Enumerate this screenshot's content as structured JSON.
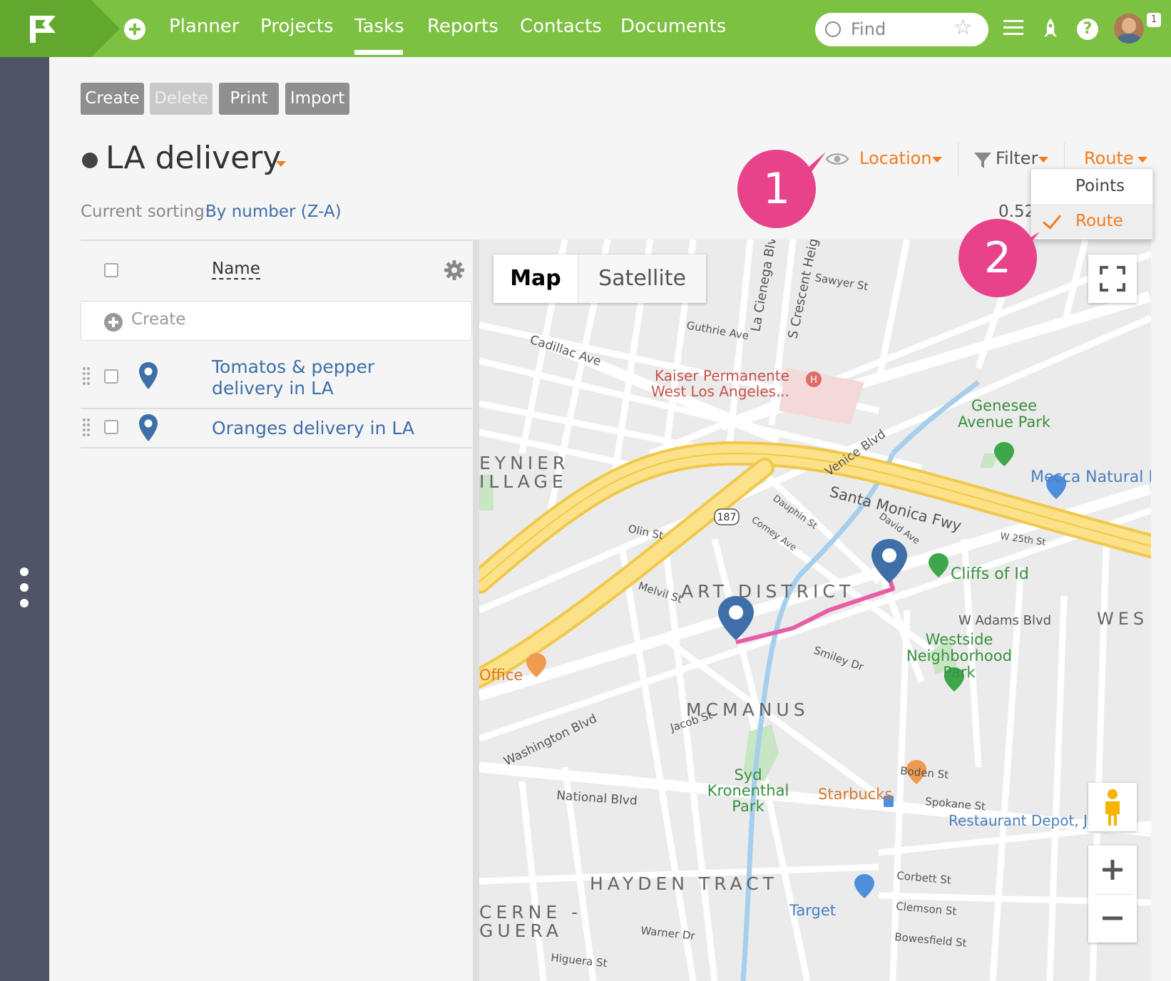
{
  "topbar": {
    "nav": [
      "Planner",
      "Projects",
      "Tasks",
      "Reports",
      "Contacts",
      "Documents"
    ],
    "active_nav": "Tasks",
    "search_placeholder": "Find",
    "notification_count": "1",
    "help_glyph": "?"
  },
  "toolbar": {
    "create": "Create",
    "delete": "Delete",
    "print": "Print",
    "import": "Import"
  },
  "header": {
    "title": "LA delivery",
    "sorting_label": "Current sorting:",
    "sorting_value": "By number (Z-A)",
    "location_label": "Location",
    "filter_label": "Filter",
    "route_label": "Route",
    "scale_text": "0.52"
  },
  "route_menu": {
    "options": [
      "Points",
      "Route"
    ],
    "selected": "Route"
  },
  "annotations": [
    "1",
    "2"
  ],
  "task_list": {
    "column_name": "Name",
    "create_label": "Create",
    "tasks": [
      {
        "name": "Tomatos & pepper delivery in LA"
      },
      {
        "name": "Oranges delivery in LA"
      }
    ]
  },
  "map": {
    "type_options": [
      "Map",
      "Satellite"
    ],
    "active_type": "Map",
    "labels": {
      "kaiser": "Kaiser Permanente",
      "kaiser2": "West Los Angeles...",
      "genesee": "Genesee",
      "genesee2": "Avenue Park",
      "mecca": "Mecca Natural M",
      "cliffs": "Cliffs of Id",
      "adams": "W Adams Blvd",
      "westside": "Westside",
      "westside2": "Neighborhood",
      "westside3": "Park",
      "art": "ART DISTRICT",
      "mcmanus": "MCMANUS",
      "hayden": "HAYDEN TRACT",
      "reynier": "EYNIER",
      "reynier2": "ILLAGE",
      "cerne": "CERNE -",
      "cerne2": "GUERA",
      "santa": "Santa Monica Fwy",
      "venice": "Venice Blvd",
      "washington": "Washington Blvd",
      "national": "National Blvd",
      "starbucks": "Starbucks",
      "restaurant": "Restaurant Depot, Jetro",
      "target": "Target",
      "office": "Office",
      "syd": "Syd",
      "syd2": "Kronenthal",
      "syd3": "Park",
      "cienega": "La Cienega Blvd",
      "crescent": "S Crescent Heigh",
      "cadillac": "Cadillac Ave",
      "guthrie": "Guthrie Ave",
      "sawyer": "Sawyer St",
      "olin": "Olin St",
      "melvil": "Melvil St",
      "jacob": "Jacob St",
      "smiley": "Smiley Dr",
      "boden": "Boden St",
      "spokane": "Spokane St",
      "corbett": "Corbett St",
      "clemson": "Clemson St",
      "bowesfield": "Bowesfield St",
      "warner": "Warner Dr",
      "higuera": "Higuera St",
      "route187": "187",
      "w25th": "W 25th St",
      "west": "WES",
      "comey": "Comey Ave",
      "dauphin": "Dauphin St",
      "david": "David Ave"
    }
  },
  "colors": {
    "brand_green": "#7dc142",
    "accent_orange": "#f27d21",
    "link_blue": "#3f6fa8",
    "annotation_pink": "#e8438a",
    "route_pink": "#e85ea6",
    "rail": "#4f5566"
  },
  "icons": [
    "logo-flag-icon",
    "add-icon",
    "search-icon",
    "star-icon",
    "menu-icon",
    "rocket-icon",
    "help-icon",
    "eye-icon",
    "filter-icon",
    "gear-icon",
    "drag-handle-icon",
    "map-pin-icon",
    "fullscreen-icon",
    "pegman-icon",
    "zoom-in-icon",
    "zoom-out-icon",
    "more-dots-icon"
  ]
}
